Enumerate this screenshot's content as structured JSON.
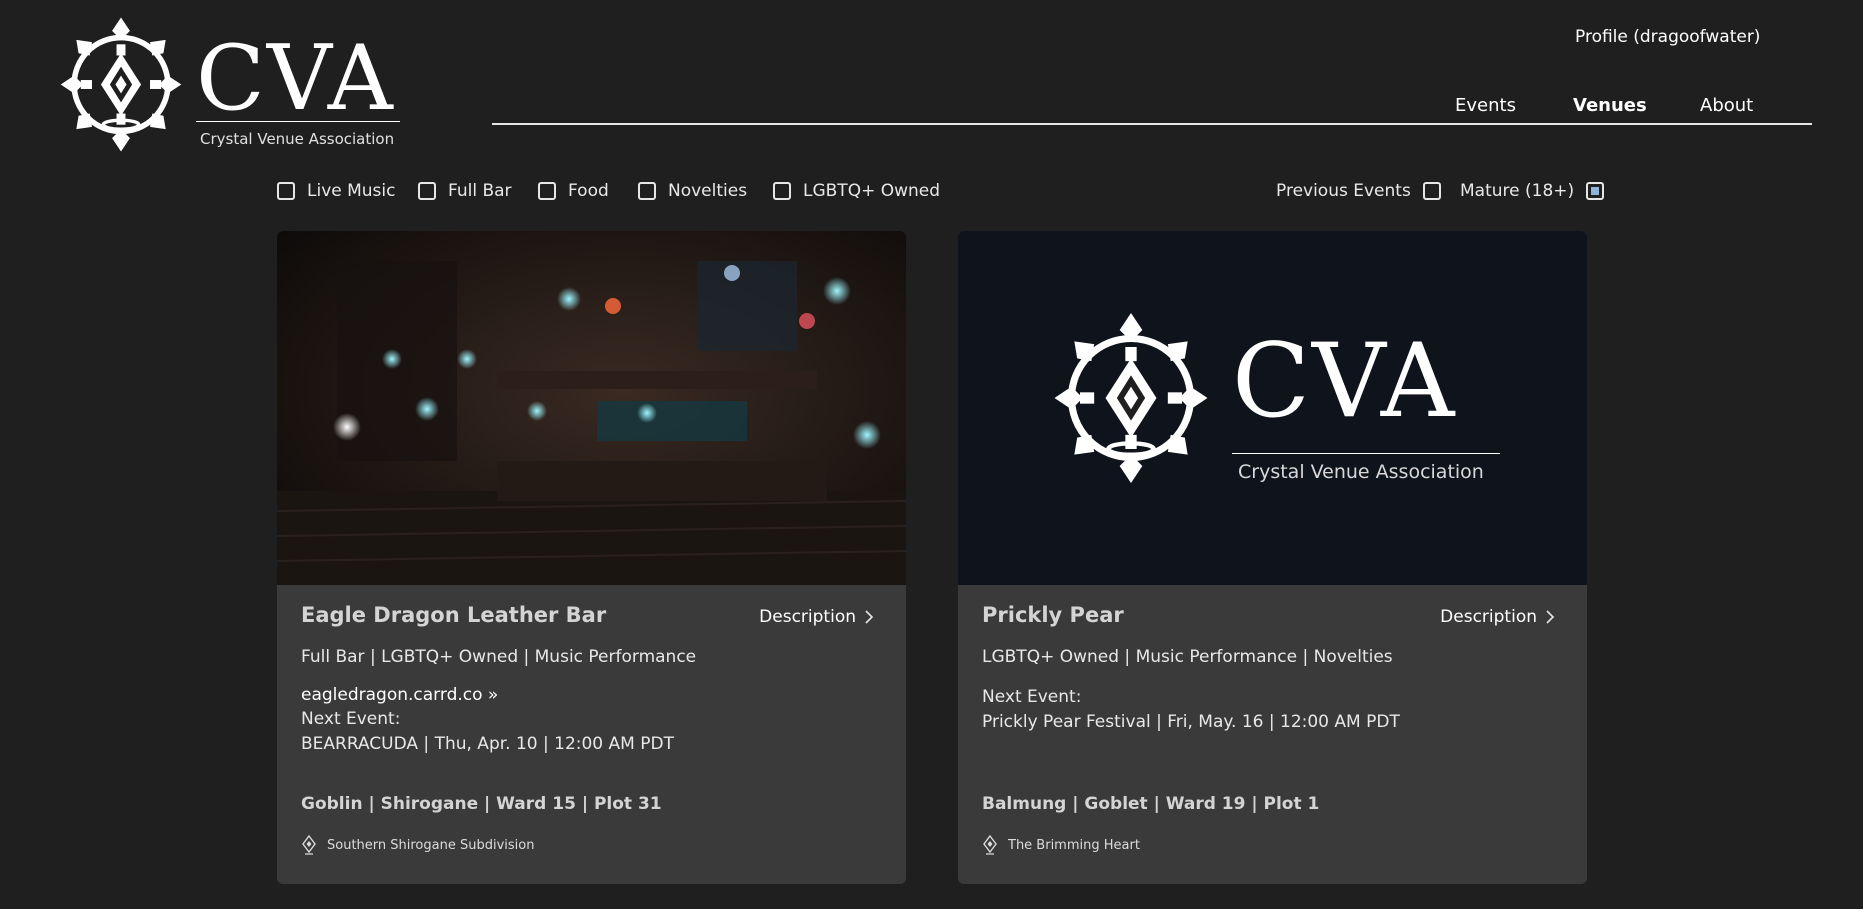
{
  "header": {
    "logo_letters": "CVA",
    "logo_subtitle": "Crystal Venue Association",
    "profile_label": "Profile (dragoofwater)",
    "nav": [
      {
        "label": "Events",
        "active": false
      },
      {
        "label": "Venues",
        "active": true
      },
      {
        "label": "About",
        "active": false
      }
    ]
  },
  "filters": {
    "left": [
      {
        "label": "Live Music",
        "checked": false
      },
      {
        "label": "Full Bar",
        "checked": false
      },
      {
        "label": "Food",
        "checked": false
      },
      {
        "label": "Novelties",
        "checked": false
      },
      {
        "label": "LGBTQ+ Owned",
        "checked": false
      }
    ],
    "right": [
      {
        "label": "Previous Events",
        "checked": false
      },
      {
        "label": "Mature (18+)",
        "checked": true
      }
    ]
  },
  "venues": [
    {
      "name": "Eagle Dragon Leather Bar",
      "description_label": "Description",
      "tags": "Full Bar | LGBTQ+ Owned | Music Performance",
      "link": "eagledragon.carrd.co »",
      "next_event_label": "Next Event:",
      "next_event": "BEARRACUDA | Thu, Apr. 10 | 12:00 AM PDT",
      "address": "Goblin | Shirogane | Ward 15 | Plot 31",
      "district": "Southern Shirogane Subdivision",
      "image": "dark-bar-interior-photo"
    },
    {
      "name": "Prickly Pear",
      "description_label": "Description",
      "tags": "LGBTQ+ Owned | Music Performance | Novelties",
      "next_event_label": "Next Event:",
      "next_event": "Prickly Pear Festival | Fri, May. 16 | 12:00 AM PDT",
      "address": "Balmung | Goblet | Ward 19 | Plot 1",
      "district": "The Brimming Heart",
      "image": "cva-logo-placeholder",
      "image_logo_letters": "CVA",
      "image_logo_subtitle": "Crystal Venue Association"
    }
  ],
  "colors": {
    "page_bg": "#1f1f1f",
    "card_bg": "#3a3a3a",
    "logo_card_bg": "#0f141c",
    "checkbox_checked": "#8fb4d8"
  }
}
